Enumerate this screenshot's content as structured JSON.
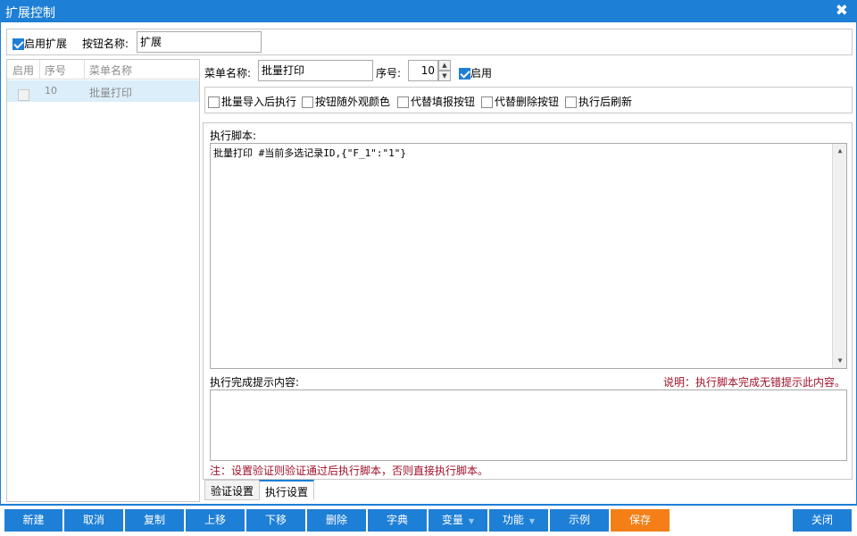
{
  "window": {
    "title": "扩展控制",
    "close_glyph": "✖"
  },
  "top": {
    "enable_label": "启用扩展",
    "enable_checked": true,
    "button_name_label": "按钮名称:",
    "button_name_value": "扩展"
  },
  "list": {
    "columns": [
      "启用",
      "序号",
      "菜单名称"
    ],
    "rows": [
      {
        "enabled": true,
        "order": "10",
        "name": "批量打印"
      }
    ]
  },
  "menu": {
    "name_label": "菜单名称:",
    "name_value": "批量打印",
    "order_label": "序号:",
    "order_value": "10",
    "enabled_label": "启用",
    "enabled_checked": true
  },
  "options": [
    {
      "label": "批量导入后执行",
      "checked": false
    },
    {
      "label": "按钮随外观颜色",
      "checked": false
    },
    {
      "label": "代替填报按钮",
      "checked": false
    },
    {
      "label": "代替删除按钮",
      "checked": false
    },
    {
      "label": "执行后刷新",
      "checked": false
    }
  ],
  "script": {
    "label": "执行脚本:",
    "value": "批量打印 #当前多选记录ID,{\"F_1\":\"1\"}"
  },
  "completion": {
    "label": "执行完成提示内容:",
    "hint": "说明：执行脚本完成无错提示此内容。",
    "value": ""
  },
  "note": "注：设置验证则验证通过后执行脚本，否则直接执行脚本。",
  "tabs": [
    {
      "label": "验证设置",
      "active": false
    },
    {
      "label": "执行设置",
      "active": true
    }
  ],
  "buttons": [
    {
      "label": "新建"
    },
    {
      "label": "取消"
    },
    {
      "label": "复制"
    },
    {
      "label": "上移"
    },
    {
      "label": "下移"
    },
    {
      "label": "删除"
    },
    {
      "label": "字典"
    },
    {
      "label": "变量",
      "dropdown": true
    },
    {
      "label": "功能",
      "dropdown": true
    },
    {
      "label": "示例"
    },
    {
      "label": "保存",
      "accent": "#f47f17"
    }
  ],
  "close_button": {
    "label": "关闭"
  },
  "colors": {
    "accent": "#1e7fd6",
    "save": "#f47f17",
    "note_red": "#a0102a"
  }
}
